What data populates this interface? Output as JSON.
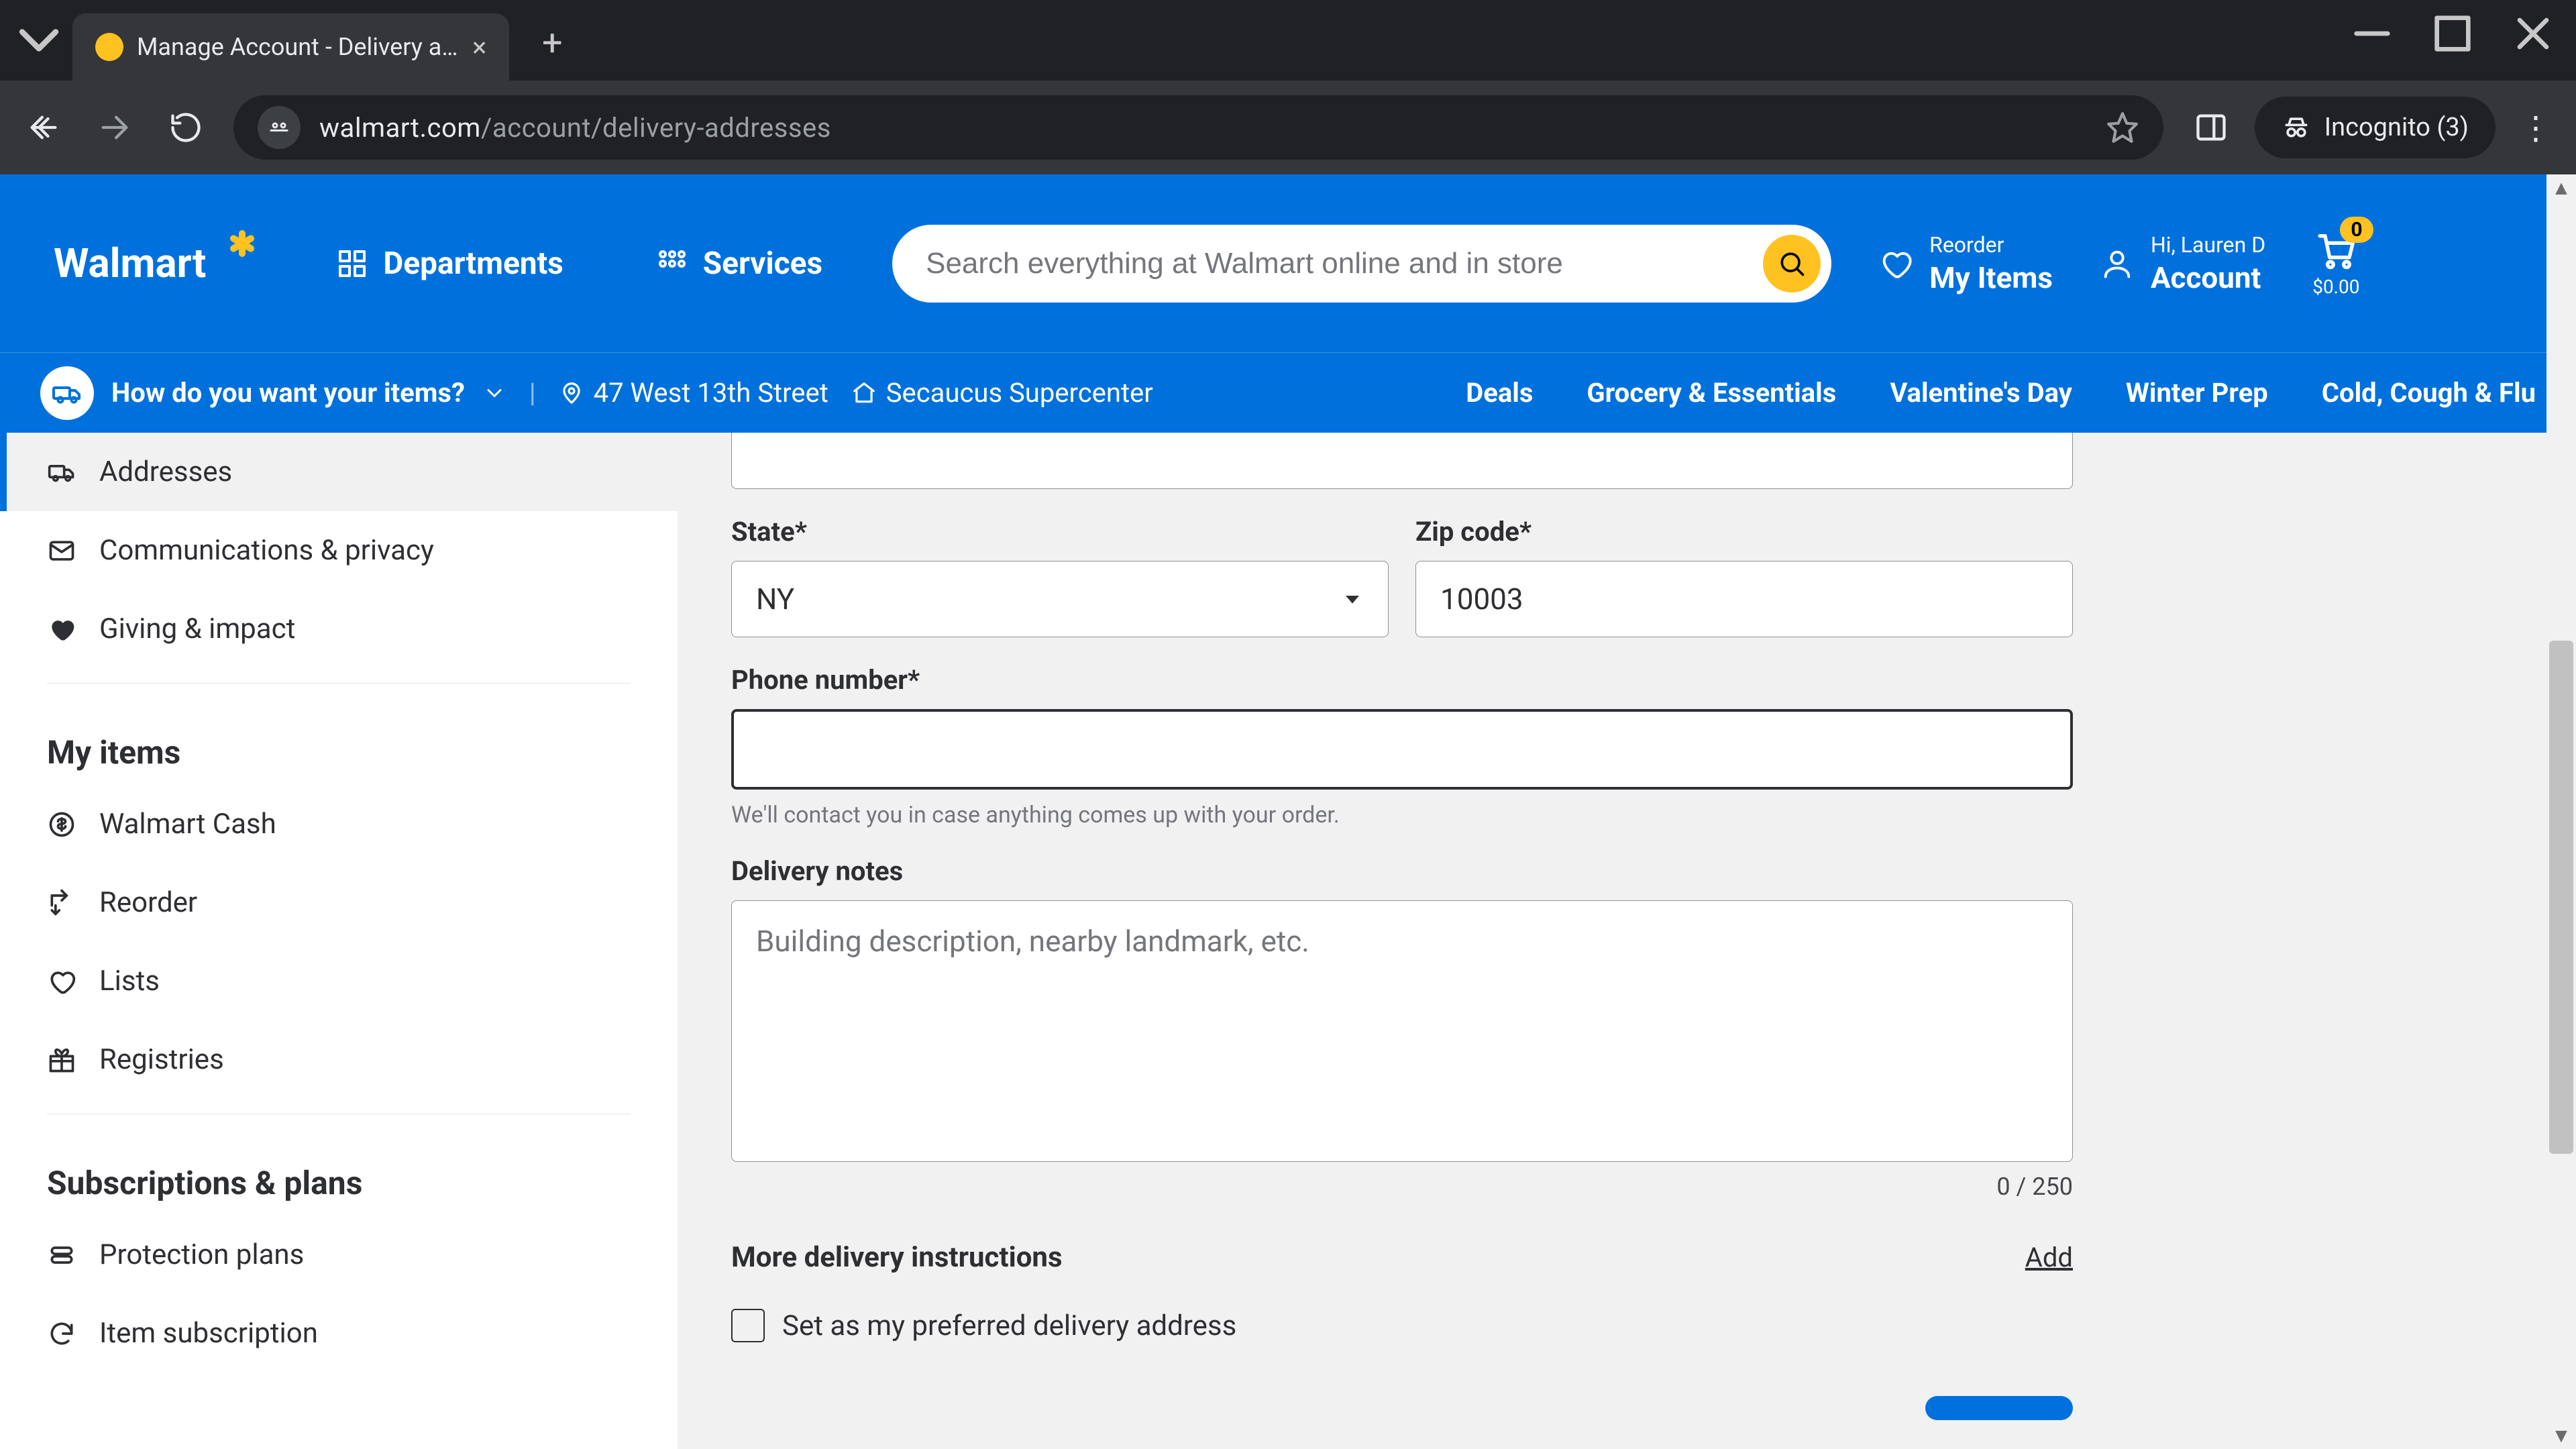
{
  "browser": {
    "tab_title": "Manage Account - Delivery add",
    "url_host": "walmart.com",
    "url_path": "/account/delivery-addresses",
    "incognito_label": "Incognito (3)"
  },
  "header": {
    "logo_text": "Walmart",
    "departments_label": "Departments",
    "services_label": "Services",
    "search_placeholder": "Search everything at Walmart online and in store",
    "reorder_small": "Reorder",
    "reorder_big": "My Items",
    "account_small": "Hi, Lauren D",
    "account_big": "Account",
    "cart_count": "0",
    "cart_total": "$0.00"
  },
  "subnav": {
    "fulfillment_label": "How do you want your items?",
    "address": "47 West 13th Street",
    "store": "Secaucus Supercenter",
    "links": [
      "Deals",
      "Grocery & Essentials",
      "Valentine's Day",
      "Winter Prep",
      "Cold, Cough & Flu"
    ]
  },
  "sidebar": {
    "items_top": [
      {
        "label": "Addresses",
        "active": true
      },
      {
        "label": "Communications & privacy"
      },
      {
        "label": "Giving & impact"
      }
    ],
    "section_myitems": "My items",
    "items_myitems": [
      {
        "label": "Walmart Cash"
      },
      {
        "label": "Reorder"
      },
      {
        "label": "Lists"
      },
      {
        "label": "Registries"
      }
    ],
    "section_subs": "Subscriptions & plans",
    "items_subs": [
      {
        "label": "Protection plans"
      },
      {
        "label": "Item subscription"
      }
    ]
  },
  "form": {
    "state_label": "State*",
    "state_value": "NY",
    "zip_label": "Zip code*",
    "zip_value": "10003",
    "phone_label": "Phone number*",
    "phone_value": "",
    "phone_hint": "We'll contact you in case anything comes up with your order.",
    "notes_label": "Delivery notes",
    "notes_placeholder": "Building description, nearby landmark, etc.",
    "notes_count": "0 / 250",
    "more_label": "More delivery instructions",
    "more_add": "Add",
    "preferred_label": "Set as my preferred delivery address"
  }
}
